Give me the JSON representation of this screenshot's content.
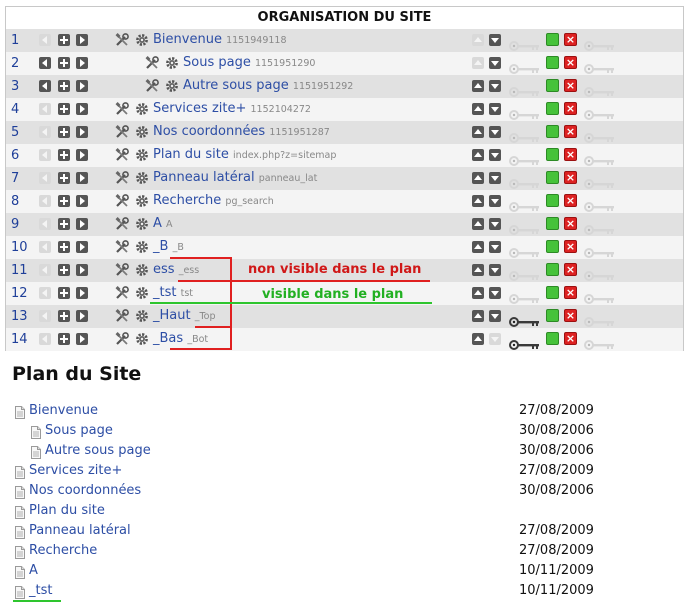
{
  "org": {
    "title": "ORGANISATION DU SITE",
    "rows": [
      {
        "num": "1",
        "title": "Bienvenue",
        "sub": "1151949118",
        "indent": 0,
        "left_enabled": false,
        "up_enabled": false,
        "down_enabled": true,
        "key_dark": false
      },
      {
        "num": "2",
        "title": "Sous page",
        "sub": "1151951290",
        "indent": 1,
        "left_enabled": true,
        "up_enabled": false,
        "down_enabled": true,
        "key_dark": false
      },
      {
        "num": "3",
        "title": "Autre sous page",
        "sub": "1151951292",
        "indent": 1,
        "left_enabled": true,
        "up_enabled": true,
        "down_enabled": true,
        "key_dark": false
      },
      {
        "num": "4",
        "title": "Services zite+",
        "sub": "1152104272",
        "indent": 0,
        "left_enabled": false,
        "up_enabled": true,
        "down_enabled": true,
        "key_dark": false
      },
      {
        "num": "5",
        "title": "Nos coordonnées",
        "sub": "1151951287",
        "indent": 0,
        "left_enabled": false,
        "up_enabled": true,
        "down_enabled": true,
        "key_dark": false
      },
      {
        "num": "6",
        "title": "Plan du site",
        "sub": "index.php?z=sitemap",
        "indent": 0,
        "left_enabled": false,
        "up_enabled": true,
        "down_enabled": true,
        "key_dark": false
      },
      {
        "num": "7",
        "title": "Panneau latéral",
        "sub": "panneau_lat",
        "indent": 0,
        "left_enabled": false,
        "up_enabled": true,
        "down_enabled": true,
        "key_dark": false
      },
      {
        "num": "8",
        "title": "Recherche",
        "sub": "pg_search",
        "indent": 0,
        "left_enabled": false,
        "up_enabled": true,
        "down_enabled": true,
        "key_dark": false
      },
      {
        "num": "9",
        "title": "A",
        "sub": "A",
        "indent": 0,
        "left_enabled": false,
        "up_enabled": true,
        "down_enabled": true,
        "key_dark": false
      },
      {
        "num": "10",
        "title": "_B",
        "sub": "_B",
        "indent": 0,
        "left_enabled": false,
        "up_enabled": true,
        "down_enabled": true,
        "key_dark": false
      },
      {
        "num": "11",
        "title": "ess",
        "sub": "_ess",
        "indent": 0,
        "left_enabled": false,
        "up_enabled": true,
        "down_enabled": true,
        "key_dark": false
      },
      {
        "num": "12",
        "title": "_tst",
        "sub": "tst",
        "indent": 0,
        "left_enabled": false,
        "up_enabled": true,
        "down_enabled": true,
        "key_dark": false
      },
      {
        "num": "13",
        "title": "_Haut",
        "sub": "_Top",
        "indent": 0,
        "left_enabled": false,
        "up_enabled": true,
        "down_enabled": true,
        "key_dark": true
      },
      {
        "num": "14",
        "title": "_Bas",
        "sub": "_Bot",
        "indent": 0,
        "left_enabled": false,
        "up_enabled": true,
        "down_enabled": false,
        "key_dark": true
      }
    ]
  },
  "annotations": {
    "not_visible": "non visible dans le plan",
    "visible": "visible dans le plan",
    "red_color": "#e02020",
    "green_color": "#2ec52e"
  },
  "plan": {
    "title": "Plan du Site",
    "items": [
      {
        "label": "Bienvenue",
        "date": "27/08/2009",
        "indent": 0
      },
      {
        "label": "Sous page",
        "date": "30/08/2006",
        "indent": 1
      },
      {
        "label": "Autre sous page",
        "date": "30/08/2006",
        "indent": 1
      },
      {
        "label": "Services zite+",
        "date": "27/08/2009",
        "indent": 0
      },
      {
        "label": "Nos coordonnées",
        "date": "30/08/2006",
        "indent": 0
      },
      {
        "label": "Plan du site",
        "date": "",
        "indent": 0
      },
      {
        "label": "Panneau latéral",
        "date": "27/08/2009",
        "indent": 0
      },
      {
        "label": "Recherche",
        "date": "27/08/2009",
        "indent": 0
      },
      {
        "label": "A",
        "date": "10/11/2009",
        "indent": 0
      },
      {
        "label": "_tst",
        "date": "10/11/2009",
        "indent": 0
      }
    ]
  },
  "icons": {
    "left_arrow": "left-arrow-icon",
    "add": "plus-icon",
    "right_arrow": "right-arrow-icon",
    "tools": "tools-icon",
    "settings": "gear-icon",
    "up": "up-arrow-icon",
    "down": "down-arrow-icon",
    "key": "key-icon",
    "visible": "green-square-icon",
    "delete": "delete-icon",
    "document": "document-icon"
  }
}
